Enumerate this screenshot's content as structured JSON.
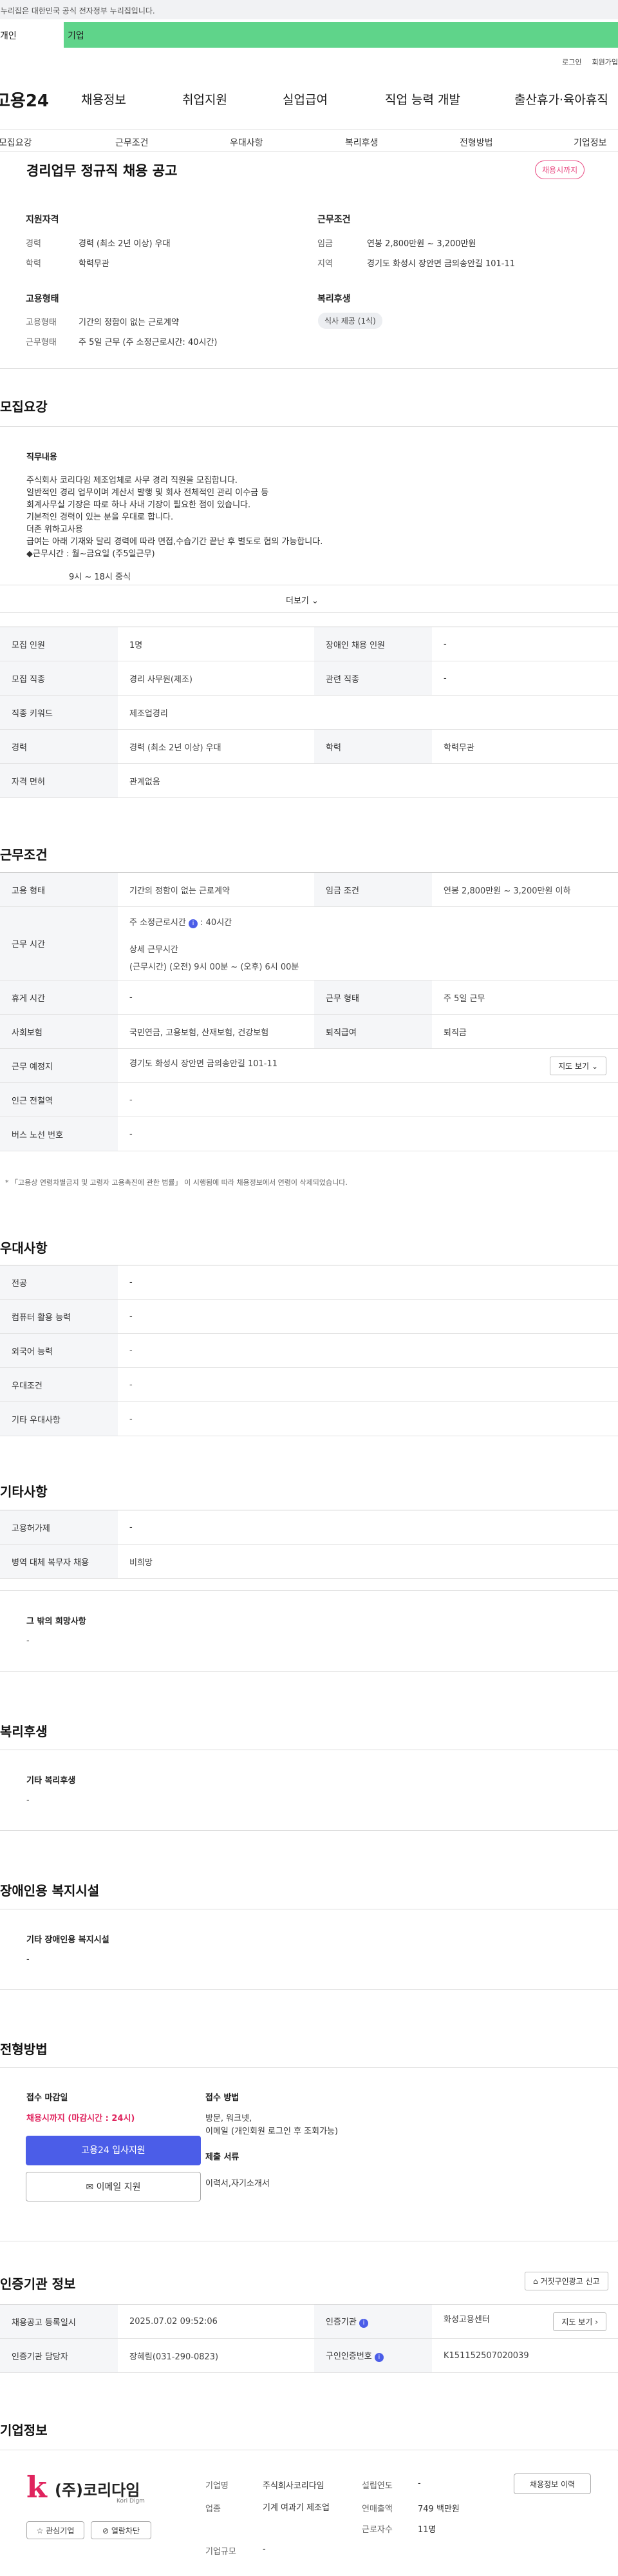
{
  "gov_banner": "이 누리집은 대한민국 공식 전자정부 누리집입니다.",
  "tabs": {
    "personal": "개인",
    "company": "기업"
  },
  "top_links": [
    "로그인",
    "회원가입"
  ],
  "logo": "고용24",
  "gnb": [
    "채용정보",
    "취업지원",
    "실업급여",
    "직업 능력 개발",
    "출산휴가·육아휴직"
  ],
  "subnav": [
    "모집요강",
    "근무조건",
    "우대사항",
    "복리후생",
    "전형방법",
    "기업정보"
  ],
  "summary": {
    "title": "경리업무 정규직 채용 공고",
    "badge": "채용시까지",
    "qual_title": "지원자격",
    "qual_rows": [
      {
        "label": "경력",
        "value": "경력 (최소 2년 이상) 우대"
      },
      {
        "label": "학력",
        "value": "학력무관"
      }
    ],
    "work_title": "근무조건",
    "work_rows": [
      {
        "label": "임금",
        "value": "연봉 2,800만원 ~ 3,200만원"
      },
      {
        "label": "지역",
        "value": "경기도 화성시 장안면 금의송안길 101-11"
      }
    ],
    "emp_title": "고용형태",
    "emp_rows": [
      {
        "label": "고용형태",
        "value": "기간의 정함이 없는 근로계약"
      },
      {
        "label": "근무형태",
        "value": "주 5일 근무 (주 소정근로시간: 40시간)"
      }
    ],
    "welfare_title": "복리후생",
    "welfare_chip": "식사 제공 (1식)"
  },
  "recruit": {
    "section_title": "모집요강",
    "job_title": "직무내용",
    "job_lines": [
      "주식회사 코리다임 제조업체로 사무 경리 직원을 모집합니다.",
      "일반적인 경리 업무이며 계산서 발행 및 회사 전체적인 관리 이수금 등",
      "회계사무실 기장은 따로 하나 사내 기장이 필요한 점이 있습니다.",
      "기본적인 경력이 있는 분을 우대로 합니다.",
      "더존 위하고사용",
      "급여는 아래 기재와 달리 경력에 따라 면접,수습기간 끝난 후 별도로 협의 가능합니다.",
      "◆근무시간 : 월~금요일 (주5일근무)",
      "9시 ~ 18시 중식"
    ],
    "more": "더보기",
    "table": [
      {
        "k1": "모집 인원",
        "v1": "1명",
        "k2": "장애인 채용 인원",
        "v2": "-"
      },
      {
        "k1": "모집 직종",
        "v1": "경리 사무원(제조)",
        "k2": "관련 직종",
        "v2": "-"
      },
      {
        "k1": "직종 키워드",
        "v1": "제조업경리"
      },
      {
        "k1": "경력",
        "v1": "경력 (최소 2년 이상) 우대",
        "k2": "학력",
        "v2": "학력무관"
      },
      {
        "k1": "자격 면허",
        "v1": "관계없음"
      }
    ]
  },
  "condition": {
    "section_title": "근무조건",
    "emp_type_k": "고용 형태",
    "emp_type_v": "기간의 정함이 없는 근로계약",
    "wage_k": "임금 조건",
    "wage_v": "연봉 2,800만원 ~ 3,200만원 이하",
    "hours_k": "근무 시간",
    "hours_weekly": "주 소정근로시간",
    "hours_weekly_val": ": 40시간",
    "hours_detail_title": "상세 근무시간",
    "hours_detail": "(근무시간) (오전) 9시 00분 ~ (오후) 6시 00분",
    "rest_k": "휴게 시간",
    "rest_v": "-",
    "worktype_k": "근무 형태",
    "worktype_v": "주 5일 근무",
    "insurance_k": "사회보험",
    "insurance_v": "국민연금, 고용보험, 산재보험, 건강보험",
    "retire_k": "퇴직급여",
    "retire_v": "퇴직금",
    "place_k": "근무 예정지",
    "place_v": "경기도 화성시 장안면 금의송안길 101-11",
    "map_btn": "지도 보기",
    "station_k": "인근 전철역",
    "station_v": "-",
    "bus_k": "버스 노선 번호",
    "bus_v": "-",
    "note": "* 「고용상 연령차별금지 및 고령자 고용촉진에 관한 법률」 이 시행됨에 따라 채용정보에서 연령이 삭제되었습니다."
  },
  "preference": {
    "section_title": "우대사항",
    "rows": [
      {
        "k": "전공",
        "v": "-"
      },
      {
        "k": "컴퓨터 활용 능력",
        "v": "-"
      },
      {
        "k": "외국어 능력",
        "v": "-"
      },
      {
        "k": "우대조건",
        "v": "-"
      },
      {
        "k": "기타 우대사항",
        "v": "-"
      }
    ]
  },
  "etc": {
    "section_title": "기타사항",
    "rows": [
      {
        "k": "고용허가제",
        "v": "-"
      },
      {
        "k": "병역 대체 복무자 채용",
        "v": "비희망"
      }
    ],
    "box_title": "그 밖의 희망사항",
    "box_value": "-"
  },
  "welfare": {
    "section_title": "복리후생",
    "box_title": "기타 복리후생",
    "box_value": "-"
  },
  "disability": {
    "section_title": "장애인용 복지시설",
    "box_title": "기타 장애인용 복지시설",
    "box_value": "-"
  },
  "process": {
    "section_title": "전형방법",
    "deadline_title": "접수 마감일",
    "deadline_value": "채용시까지 (마감시간 : 24시)",
    "apply_btn": "고용24 입사지원",
    "email_btn": "이메일 지원",
    "method_title": "접수 방법",
    "method_lines": [
      "방문, 워크넷,",
      "이메일 (개인회원 로그인 후 조회가능)"
    ],
    "docs_title": "제출 서류",
    "docs_value": "이력서,자기소개서"
  },
  "cert": {
    "section_title": "인증기관 정보",
    "report_btn": "거짓구인광고 신고",
    "rows": [
      {
        "k1": "채용공고 등록일시",
        "v1": "2025.07.02 09:52:06",
        "k2": "인증기관",
        "v2": "화성고용센터",
        "btn": "지도 보기"
      },
      {
        "k1": "인증기관 담당자",
        "v1": "장혜림(031-290-0823)",
        "k2": "구인인증번호",
        "v2": "K151152507020039"
      }
    ]
  },
  "company": {
    "section_title": "기업정보",
    "logo_text": "(주)코리다임",
    "logo_sub": "Kori Digm",
    "interest_btn": "관심기업",
    "block_btn": "열람차단",
    "fields": [
      {
        "k": "기업명",
        "v": "주식회사코리다임"
      },
      {
        "k": "업종",
        "v": "기계 여과기 제조업"
      },
      {
        "k": "기업규모",
        "v": "-"
      }
    ],
    "fields2": [
      {
        "k": "설립연도",
        "v": "-"
      },
      {
        "k": "연매출액",
        "v": "749 백만원"
      },
      {
        "k": "근로자수",
        "v": "11명"
      }
    ],
    "history_btn": "채용정보 이력"
  }
}
